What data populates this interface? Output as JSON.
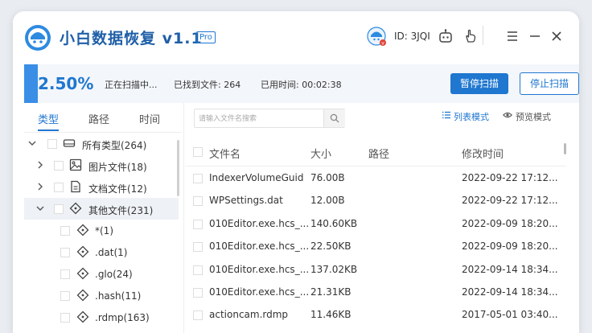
{
  "app": {
    "title": "小白数据恢复 v1.1",
    "badge": "Pro",
    "user_id": "ID: 3JQI",
    "accent_color": "#1f77d0",
    "icons": [
      "logo-icon",
      "avatar-icon",
      "robot-icon",
      "hand-icon",
      "menu-icon",
      "minimize-icon",
      "close-icon"
    ]
  },
  "status": {
    "percent": "2.50%",
    "progress_fraction": 0.025,
    "scanning_text": "正在扫描中...",
    "found_text": "已找到文件: 264",
    "elapsed_text": "已用时间: 00:02:38",
    "pause_label": "暂停扫描",
    "stop_label": "停止扫描"
  },
  "tabs": [
    {
      "label": "类型",
      "active": true
    },
    {
      "label": "路径",
      "active": false
    },
    {
      "label": "时间",
      "active": false
    }
  ],
  "tree": [
    {
      "label": "所有类型(264)",
      "icon": "drive-icon",
      "expanded": true
    },
    {
      "label": "图片文件(18)",
      "icon": "image-icon",
      "expanded": false
    },
    {
      "label": "文档文件(12)",
      "icon": "document-icon",
      "expanded": false
    },
    {
      "label": "其他文件(231)",
      "icon": "diamond-icon",
      "expanded": true,
      "selected": true
    },
    {
      "label": "*(1)",
      "icon": "diamond-icon"
    },
    {
      "label": ".dat(1)",
      "icon": "diamond-icon"
    },
    {
      "label": ".glo(24)",
      "icon": "diamond-icon"
    },
    {
      "label": ".hash(11)",
      "icon": "diamond-icon"
    },
    {
      "label": ".rdmp(163)",
      "icon": "diamond-icon"
    }
  ],
  "search": {
    "placeholder": "请输入文件名搜索"
  },
  "view_modes": {
    "list": "列表模式",
    "preview": "预览模式"
  },
  "table": {
    "headers": {
      "name": "文件名",
      "size": "大小",
      "path": "路径",
      "modified": "修改时间"
    },
    "rows": [
      {
        "name": "IndexerVolumeGuid",
        "size": "76.00B",
        "path": "",
        "modified": "2022-09-22 17:12..."
      },
      {
        "name": "WPSettings.dat",
        "size": "12.00B",
        "path": "",
        "modified": "2022-09-22 17:12..."
      },
      {
        "name": "010Editor.exe.hcs_...",
        "size": "140.60KB",
        "path": "",
        "modified": "2022-09-09 18:20..."
      },
      {
        "name": "010Editor.exe.hcs_...",
        "size": "22.50KB",
        "path": "",
        "modified": "2022-09-09 18:20..."
      },
      {
        "name": "010Editor.exe.hcs_...",
        "size": "137.02KB",
        "path": "",
        "modified": "2022-09-14 18:34..."
      },
      {
        "name": "010Editor.exe.hcs_...",
        "size": "21.31KB",
        "path": "",
        "modified": "2022-09-14 18:34..."
      },
      {
        "name": "actioncam.rdmp",
        "size": "11.46KB",
        "path": "",
        "modified": "2017-05-01 03:40..."
      }
    ]
  }
}
